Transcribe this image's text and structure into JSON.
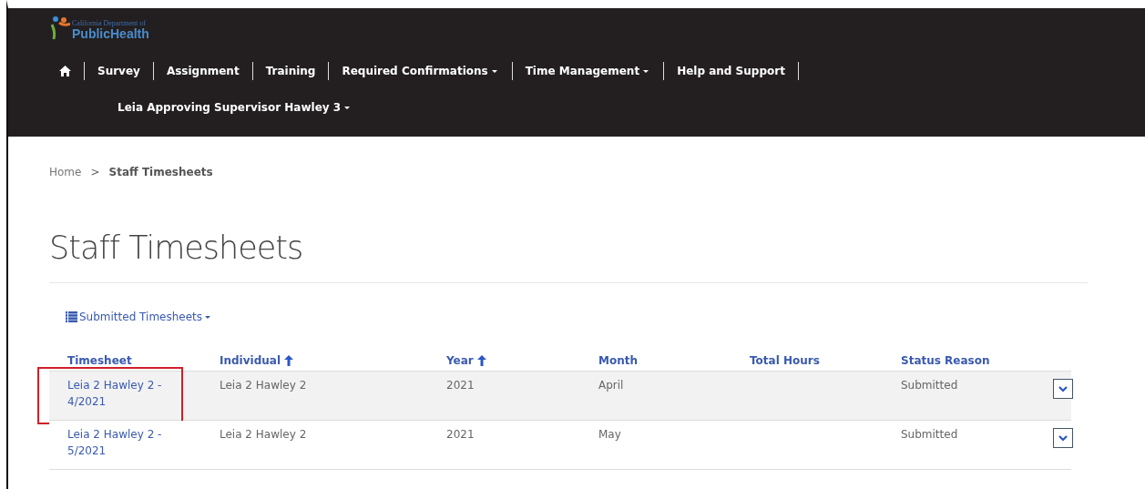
{
  "header": {
    "logo": {
      "small": "California Department of",
      "large": "PublicHealth"
    },
    "nav": [
      {
        "label": "Survey",
        "dropdown": false
      },
      {
        "label": "Assignment",
        "dropdown": false
      },
      {
        "label": "Training",
        "dropdown": false
      },
      {
        "label": "Required Confirmations",
        "dropdown": true
      },
      {
        "label": "Time Management",
        "dropdown": true
      },
      {
        "label": "Help and Support",
        "dropdown": false
      }
    ],
    "user": "Leia Approving Supervisor Hawley 3"
  },
  "breadcrumb": [
    {
      "label": "Home",
      "current": false
    },
    {
      "label": "Staff Timesheets",
      "current": true
    }
  ],
  "breadcrumb_separator": ">",
  "title": "Staff Timesheets",
  "view_selector": "Submitted Timesheets",
  "table": {
    "columns": [
      {
        "label": "Timesheet",
        "sorted": false
      },
      {
        "label": "Individual",
        "sorted": true
      },
      {
        "label": "Year",
        "sorted": true
      },
      {
        "label": "Month",
        "sorted": false
      },
      {
        "label": "Total Hours",
        "sorted": false
      },
      {
        "label": "Status Reason",
        "sorted": false
      }
    ],
    "rows": [
      {
        "cells": [
          "Leia 2 Hawley 2 - 4/2021",
          "Leia 2 Hawley 2",
          "2021",
          "April",
          "",
          "Submitted"
        ],
        "highlighted": true,
        "outlined": true
      },
      {
        "cells": [
          "Leia 2 Hawley 2 - 5/2021",
          "Leia 2 Hawley 2",
          "2021",
          "May",
          "",
          "Submitted"
        ],
        "highlighted": false,
        "outlined": false
      }
    ]
  }
}
